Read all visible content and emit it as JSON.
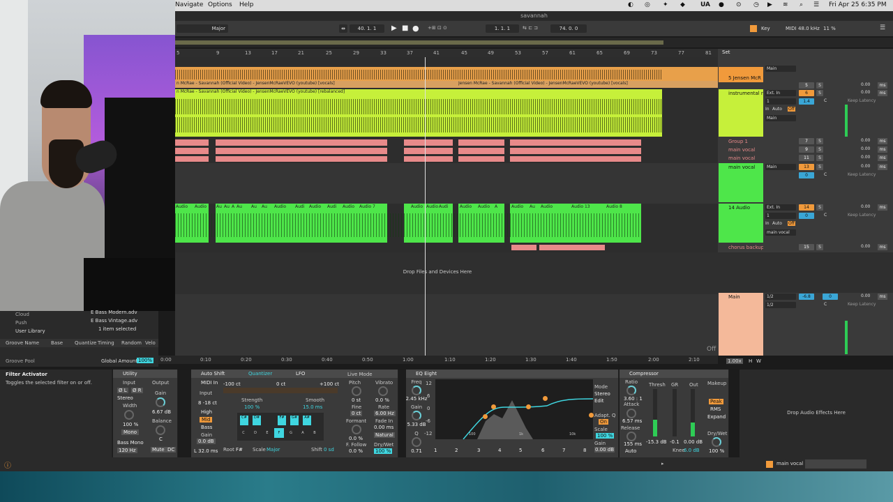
{
  "menubar": {
    "menus": [
      "Navigate",
      "Options",
      "Help"
    ],
    "status_items": [
      "UA"
    ],
    "datetime": "Fri Apr 25  6:35 PM"
  },
  "window": {
    "title": "savannah"
  },
  "transport": {
    "tempo": "40.  1.  1",
    "position": "1.   1.   1",
    "end": "74.   0.   0",
    "key_label": "Key",
    "midi_label": "MIDI",
    "sample_rate": "48.0 kHz",
    "cpu": "11 %",
    "scale_select": "Major"
  },
  "ruler": {
    "bars": [
      "5",
      "9",
      "13",
      "17",
      "21",
      "25",
      "29",
      "33",
      "37",
      "41",
      "45",
      "49",
      "53",
      "57",
      "61",
      "65",
      "69",
      "73",
      "77",
      "81"
    ],
    "set_label": "Set"
  },
  "clips": {
    "vocal_clip": "n McRae - Savannah (Official Video) - JensenMcRaeVEVO (youtube) [vocals]",
    "vocal_clip_2": "Jensen McRae - Savannah (Official Video) - JensenMcRaeVEVO (youtube) [vocals]",
    "inst_clip": "n McRae - Savannah (Official Video) - JensenMcRaeVEVO (youtube) [rebalanced]",
    "audio_labels": [
      "Audio",
      "Audio",
      "Au",
      "Au",
      "A",
      "Au",
      "Au",
      "Au",
      "Audio",
      "Audi",
      "Audio",
      "Audi",
      "Audio",
      "Audio 7",
      "Audio",
      "Audio",
      "Audi",
      "Audio",
      "Audio",
      "A",
      "Audio",
      "Au",
      "Audio",
      "Audio 13",
      "Audio 8"
    ],
    "drop_text": "Drop Files and Devices Here"
  },
  "time_ruler": [
    "0:00",
    "0:10",
    "0:20",
    "0:30",
    "0:40",
    "0:50",
    "1:00",
    "1:10",
    "1:20",
    "1:30",
    "1:40",
    "1:50",
    "2:00",
    "2:10"
  ],
  "tracks": [
    {
      "name": "5 Jensen McR",
      "color": "#f19a3b",
      "routing": "Main",
      "num": "5",
      "vol": "0.00"
    },
    {
      "name": "instrumental r",
      "color": "#c6f03a",
      "input": "Ext. In",
      "ch": "1",
      "monitor": [
        "In",
        "Auto",
        "Off"
      ],
      "out": "Main",
      "num": "6",
      "vol": "0.00",
      "pan_val": "1.4",
      "pan": "C",
      "latency": "Keep Latency"
    },
    {
      "name": "Group 1",
      "color": "#e88a8a",
      "num": "7",
      "vol": "0.00"
    },
    {
      "name": "main vocal",
      "color": "#e88a8a",
      "num": "9",
      "vol": "0.00"
    },
    {
      "name": "main vocal",
      "color": "#e88a8a",
      "num": "11",
      "vol": "0.00"
    },
    {
      "name": "main vocal",
      "color": "#4ee64a",
      "routing": "Main",
      "num": "13",
      "vol": "0.00",
      "pan_val": "0",
      "pan": "C",
      "latency": "Keep Latency"
    },
    {
      "name": "14 Audio",
      "color": "#4ee64a",
      "input": "Ext. In",
      "ch": "1",
      "monitor": [
        "In",
        "Auto",
        "Off"
      ],
      "out": "main vocal",
      "num": "14",
      "vol": "0.00",
      "pan_val": "0",
      "pan": "C",
      "latency": "Keep Latency"
    },
    {
      "name": "chorus backup",
      "color": "#e88a8a",
      "num": "15",
      "vol": "0.00"
    },
    {
      "name": "Main",
      "color": "#f4b99a",
      "routing": "1/2",
      "routing2": "1/2",
      "vol": "0.00",
      "pan_val": "-6.8",
      "pan_val2": "0",
      "pan": "C",
      "latency": "Keep Latency"
    }
  ],
  "mixer_misc": {
    "unit": "ms",
    "s_label": "S",
    "off_label": "Off",
    "zoom": "1.00x",
    "h_label": "H",
    "w_label": "W"
  },
  "browser": {
    "places": [
      "Cloud",
      "Push",
      "User Library"
    ],
    "files": [
      "E Bass Modern.adv",
      "E Bass Vintage.adv"
    ],
    "selected_count": "1 item selected",
    "groove_cols": [
      "Groove Name",
      "Base",
      "Quantize",
      "Timing",
      "Random",
      "Velo"
    ],
    "groove_pool": "Groove Pool",
    "global_amount_label": "Global Amount",
    "global_amount": "100%"
  },
  "info": {
    "title": "Filter Activator",
    "text": "Toggles the selected filter on or off."
  },
  "utility": {
    "title": "Utility",
    "input_label": "Input",
    "output_label": "Output",
    "phase_l": "Ø L",
    "phase_r": "Ø R",
    "mode": "Stereo",
    "width_label": "Width",
    "width": "100 %",
    "mono": "Mono",
    "bass_mono": "Bass Mono",
    "bass_freq": "120 Hz",
    "gain_label": "Gain",
    "gain": "6.67 dB",
    "balance_label": "Balance",
    "balance": "C",
    "mute": "Mute",
    "dc": "DC"
  },
  "autoshift": {
    "title": "Auto Shift",
    "quantizer_tab": "Quantizer",
    "lfo_tab": "LFO",
    "midi_in": "MIDI In",
    "input_label": "Input",
    "range_lo": "-100 ct",
    "range_mid": "0 ct",
    "range_hi": "+100 ct",
    "strength_label": "Strength",
    "strength": "100 %",
    "smooth_label": "Smooth",
    "smooth": "15.0 ms",
    "high": "High",
    "mid": "Mid",
    "bass": "Bass",
    "gain_label": "Gain",
    "gain": "0.0 dB",
    "lat": "L 32.0 ms",
    "keys_top": [
      "C#",
      "D#",
      "F#",
      "G#",
      "A#"
    ],
    "keys_bottom": [
      "C",
      "D",
      "E",
      "F",
      "G",
      "A",
      "B"
    ],
    "root_label": "Root",
    "root": "F#",
    "scale_label": "Scale",
    "scale": "Major",
    "shift_label": "Shift",
    "shift": "0 sd",
    "offset": "8 -18 ct",
    "live_mode": "Live Mode",
    "pitch_label": "Pitch",
    "pitch": "0 st",
    "fine_label": "Fine",
    "fine": "0 ct",
    "formant_label": "Formant",
    "formant": "0.0 %",
    "ffollow_label": "F. Follow",
    "ffollow": "0.0 %",
    "vibrato_label": "Vibrato",
    "vibrato": "0.0 %",
    "rate_label": "Rate",
    "rate": "6.00 Hz",
    "fadein_label": "Fade In",
    "fadein": "0.00 ms",
    "natural": "Natural",
    "drywet_label": "Dry/Wet",
    "drywet": "100 %"
  },
  "eq": {
    "title": "EQ Eight",
    "freq_label": "Freq",
    "freq": "2.45 kHz",
    "gain_label": "Gain",
    "gain": "5.33 dB",
    "q_label": "Q",
    "q": "0.71",
    "db_scale": [
      "12",
      "6",
      "0",
      "-6",
      "-12"
    ],
    "hz_marks": [
      "100",
      "1k",
      "10k"
    ],
    "bands": [
      "1",
      "2",
      "3",
      "4",
      "5",
      "6",
      "7",
      "8"
    ],
    "mode_label": "Mode",
    "mode": "Stereo",
    "edit": "Edit",
    "adapt_q": "Adapt. Q",
    "on": "On",
    "scale_label": "Scale",
    "scale": "100 %",
    "out_gain_label": "Gain",
    "out_gain": "0.00 dB"
  },
  "compressor": {
    "title": "Compressor",
    "ratio_label": "Ratio",
    "ratio": "3.60 : 1",
    "attack_label": "Attack",
    "attack": "6.57 ms",
    "release_label": "Release",
    "release": "155 ms",
    "auto": "Auto",
    "thresh_label": "Thresh",
    "thresh": "-15.3 dB",
    "gr_label": "GR",
    "gr": "-0.1",
    "out_label": "Out",
    "out": "0.00 dB",
    "makeup": "Makeup",
    "peak": "Peak",
    "rms": "RMS",
    "expand": "Expand",
    "knee_label": "Knee",
    "knee": "6.0 dB",
    "drywet_label": "Dry/Wet",
    "drywet": "100 %"
  },
  "drop_effects": "Drop Audio Effects Here",
  "statusbar": {
    "track": "main vocal"
  },
  "colors": {
    "orange": "#f19a3b",
    "lime": "#c6f03a",
    "pink": "#e88a8a",
    "green": "#4ee64a",
    "peach": "#f4b99a",
    "cyan": "#3fd6e0"
  }
}
